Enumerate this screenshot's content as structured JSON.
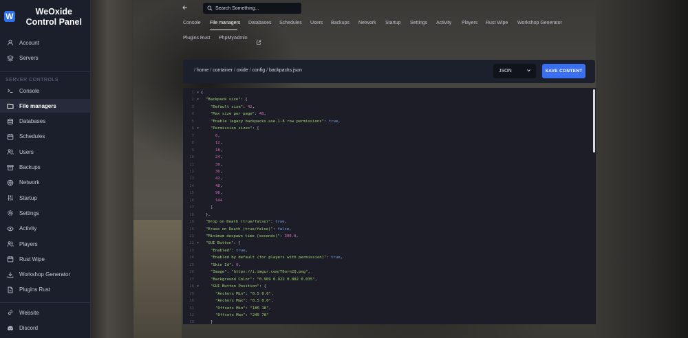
{
  "brand": {
    "logo_letter": "W",
    "name": "WeOxide Control Panel"
  },
  "sidebar": {
    "top_items": [
      {
        "label": "Account",
        "icon": "user-icon"
      },
      {
        "label": "Servers",
        "icon": "layers-icon"
      }
    ],
    "section_label": "SERVER CONTROLS",
    "items": [
      {
        "label": "Console",
        "icon": "terminal-icon"
      },
      {
        "label": "File managers",
        "icon": "folder-icon",
        "active": true
      },
      {
        "label": "Databases",
        "icon": "database-icon"
      },
      {
        "label": "Schedules",
        "icon": "calendar-icon"
      },
      {
        "label": "Users",
        "icon": "users-icon"
      },
      {
        "label": "Backups",
        "icon": "archive-icon"
      },
      {
        "label": "Network",
        "icon": "globe-icon"
      },
      {
        "label": "Startup",
        "icon": "sliders-icon"
      },
      {
        "label": "Settings",
        "icon": "gear-icon"
      },
      {
        "label": "Activity",
        "icon": "eye-icon"
      },
      {
        "label": "Players",
        "icon": "users-icon"
      },
      {
        "label": "Rust Wipe",
        "icon": "calendar-icon"
      },
      {
        "label": "Workshop Generator",
        "icon": "download-icon"
      },
      {
        "label": "Plugins Rust",
        "icon": "file-icon"
      }
    ],
    "bottom_items": [
      {
        "label": "Website",
        "icon": "link-icon"
      },
      {
        "label": "Discord",
        "icon": "discord-icon"
      }
    ]
  },
  "topbar": {
    "search_placeholder": "Search Something..."
  },
  "tabs": [
    "Console",
    "File managers",
    "Databases",
    "Schedules",
    "Users",
    "Backups",
    "Network",
    "Startup",
    "Settings",
    "Activity",
    "Players",
    "Rust Wipe",
    "Workshop Generator",
    "Plugins Rust",
    "PhpMyAdmin"
  ],
  "active_tab": "File managers",
  "path": {
    "crumbs": [
      "home",
      "container",
      "oxide",
      "config",
      "backpacks.json"
    ]
  },
  "editor": {
    "language": "JSON",
    "save_label": "SAVE CONTENT",
    "lines": [
      {
        "ln": "1",
        "fold": "▾",
        "indent": 0,
        "parts": [
          {
            "t": "{",
            "c": "p"
          }
        ]
      },
      {
        "ln": "2",
        "fold": "▾",
        "indent": 1,
        "parts": [
          {
            "t": "\"Backpack size\"",
            "c": "k"
          },
          {
            "t": ": {",
            "c": "p"
          }
        ]
      },
      {
        "ln": "3",
        "fold": "",
        "indent": 2,
        "parts": [
          {
            "t": "\"Default size\"",
            "c": "k"
          },
          {
            "t": ": ",
            "c": "p"
          },
          {
            "t": "42",
            "c": "n"
          },
          {
            "t": ",",
            "c": "p"
          }
        ]
      },
      {
        "ln": "4",
        "fold": "",
        "indent": 2,
        "parts": [
          {
            "t": "\"Max size per page\"",
            "c": "k"
          },
          {
            "t": ": ",
            "c": "p"
          },
          {
            "t": "48",
            "c": "n"
          },
          {
            "t": ",",
            "c": "p"
          }
        ]
      },
      {
        "ln": "5",
        "fold": "",
        "indent": 2,
        "parts": [
          {
            "t": "\"Enable legacy backpacks.use.1-8 row permissions\"",
            "c": "k"
          },
          {
            "t": ": ",
            "c": "p"
          },
          {
            "t": "true",
            "c": "b"
          },
          {
            "t": ",",
            "c": "p"
          }
        ]
      },
      {
        "ln": "6",
        "fold": "▾",
        "indent": 2,
        "parts": [
          {
            "t": "\"Permission sizes\"",
            "c": "k"
          },
          {
            "t": ": [",
            "c": "p"
          }
        ]
      },
      {
        "ln": "7",
        "fold": "",
        "indent": 3,
        "parts": [
          {
            "t": "6",
            "c": "n"
          },
          {
            "t": ",",
            "c": "p"
          }
        ]
      },
      {
        "ln": "8",
        "fold": "",
        "indent": 3,
        "parts": [
          {
            "t": "12",
            "c": "n"
          },
          {
            "t": ",",
            "c": "p"
          }
        ]
      },
      {
        "ln": "9",
        "fold": "",
        "indent": 3,
        "parts": [
          {
            "t": "18",
            "c": "n"
          },
          {
            "t": ",",
            "c": "p"
          }
        ]
      },
      {
        "ln": "10",
        "fold": "",
        "indent": 3,
        "parts": [
          {
            "t": "24",
            "c": "n"
          },
          {
            "t": ",",
            "c": "p"
          }
        ]
      },
      {
        "ln": "11",
        "fold": "",
        "indent": 3,
        "parts": [
          {
            "t": "30",
            "c": "n"
          },
          {
            "t": ",",
            "c": "p"
          }
        ]
      },
      {
        "ln": "12",
        "fold": "",
        "indent": 3,
        "parts": [
          {
            "t": "36",
            "c": "n"
          },
          {
            "t": ",",
            "c": "p"
          }
        ]
      },
      {
        "ln": "13",
        "fold": "",
        "indent": 3,
        "parts": [
          {
            "t": "42",
            "c": "n"
          },
          {
            "t": ",",
            "c": "p"
          }
        ]
      },
      {
        "ln": "14",
        "fold": "",
        "indent": 3,
        "parts": [
          {
            "t": "48",
            "c": "n"
          },
          {
            "t": ",",
            "c": "p"
          }
        ]
      },
      {
        "ln": "15",
        "fold": "",
        "indent": 3,
        "parts": [
          {
            "t": "96",
            "c": "n"
          },
          {
            "t": ",",
            "c": "p"
          }
        ]
      },
      {
        "ln": "16",
        "fold": "",
        "indent": 3,
        "parts": [
          {
            "t": "144",
            "c": "n"
          }
        ]
      },
      {
        "ln": "17",
        "fold": "",
        "indent": 2,
        "parts": [
          {
            "t": "]",
            "c": "p"
          }
        ]
      },
      {
        "ln": "18",
        "fold": "",
        "indent": 1,
        "parts": [
          {
            "t": "},",
            "c": "p"
          }
        ]
      },
      {
        "ln": "19",
        "fold": "",
        "indent": 1,
        "parts": [
          {
            "t": "\"Drop on Death (true/false)\"",
            "c": "k"
          },
          {
            "t": ": ",
            "c": "p"
          },
          {
            "t": "true",
            "c": "b"
          },
          {
            "t": ",",
            "c": "p"
          }
        ]
      },
      {
        "ln": "20",
        "fold": "",
        "indent": 1,
        "parts": [
          {
            "t": "\"Erase on Death (true/false)\"",
            "c": "k"
          },
          {
            "t": ": ",
            "c": "p"
          },
          {
            "t": "false",
            "c": "b"
          },
          {
            "t": ",",
            "c": "p"
          }
        ]
      },
      {
        "ln": "21",
        "fold": "",
        "indent": 1,
        "parts": [
          {
            "t": "\"Minimum despawn time (seconds)\"",
            "c": "k"
          },
          {
            "t": ": ",
            "c": "p"
          },
          {
            "t": "300.0",
            "c": "n"
          },
          {
            "t": ",",
            "c": "p"
          }
        ]
      },
      {
        "ln": "22",
        "fold": "▾",
        "indent": 1,
        "parts": [
          {
            "t": "\"GUI Button\"",
            "c": "k"
          },
          {
            "t": ": {",
            "c": "p"
          }
        ]
      },
      {
        "ln": "23",
        "fold": "",
        "indent": 2,
        "parts": [
          {
            "t": "\"Enabled\"",
            "c": "k"
          },
          {
            "t": ": ",
            "c": "p"
          },
          {
            "t": "true",
            "c": "b"
          },
          {
            "t": ",",
            "c": "p"
          }
        ]
      },
      {
        "ln": "24",
        "fold": "",
        "indent": 2,
        "parts": [
          {
            "t": "\"Enabled by default (for players with permission)\"",
            "c": "k"
          },
          {
            "t": ": ",
            "c": "p"
          },
          {
            "t": "true",
            "c": "b"
          },
          {
            "t": ",",
            "c": "p"
          }
        ]
      },
      {
        "ln": "25",
        "fold": "",
        "indent": 2,
        "parts": [
          {
            "t": "\"Skin Id\"",
            "c": "k"
          },
          {
            "t": ": ",
            "c": "p"
          },
          {
            "t": "0",
            "c": "n"
          },
          {
            "t": ",",
            "c": "p"
          }
        ]
      },
      {
        "ln": "26",
        "fold": "",
        "indent": 2,
        "parts": [
          {
            "t": "\"Image\"",
            "c": "k"
          },
          {
            "t": ": ",
            "c": "p"
          },
          {
            "t": "\"https://i.imgur.com/T6orn2Q.png\"",
            "c": "k"
          },
          {
            "t": ",",
            "c": "p"
          }
        ]
      },
      {
        "ln": "27",
        "fold": "",
        "indent": 2,
        "parts": [
          {
            "t": "\"Background Color\"",
            "c": "k"
          },
          {
            "t": ": ",
            "c": "p"
          },
          {
            "t": "\"0.969 0.922 0.882 0.035\"",
            "c": "k"
          },
          {
            "t": ",",
            "c": "p"
          }
        ]
      },
      {
        "ln": "28",
        "fold": "▾",
        "indent": 2,
        "parts": [
          {
            "t": "\"GUI Button Position\"",
            "c": "k"
          },
          {
            "t": ": {",
            "c": "p"
          }
        ]
      },
      {
        "ln": "29",
        "fold": "",
        "indent": 3,
        "parts": [
          {
            "t": "\"Anchors Min\"",
            "c": "k"
          },
          {
            "t": ": ",
            "c": "p"
          },
          {
            "t": "\"0.5 0.0\"",
            "c": "k"
          },
          {
            "t": ",",
            "c": "p"
          }
        ]
      },
      {
        "ln": "30",
        "fold": "",
        "indent": 3,
        "parts": [
          {
            "t": "\"Anchors Max\"",
            "c": "k"
          },
          {
            "t": ": ",
            "c": "p"
          },
          {
            "t": "\"0.5 0.0\"",
            "c": "k"
          },
          {
            "t": ",",
            "c": "p"
          }
        ]
      },
      {
        "ln": "31",
        "fold": "",
        "indent": 3,
        "parts": [
          {
            "t": "\"Offsets Min\"",
            "c": "k"
          },
          {
            "t": ": ",
            "c": "p"
          },
          {
            "t": "\"185 18\"",
            "c": "k"
          },
          {
            "t": ",",
            "c": "p"
          }
        ]
      },
      {
        "ln": "32",
        "fold": "",
        "indent": 3,
        "parts": [
          {
            "t": "\"Offsets Max\"",
            "c": "k"
          },
          {
            "t": ": ",
            "c": "p"
          },
          {
            "t": "\"245 78\"",
            "c": "k"
          }
        ]
      },
      {
        "ln": "33",
        "fold": "",
        "indent": 2,
        "parts": [
          {
            "t": "}",
            "c": "p"
          }
        ]
      }
    ]
  }
}
